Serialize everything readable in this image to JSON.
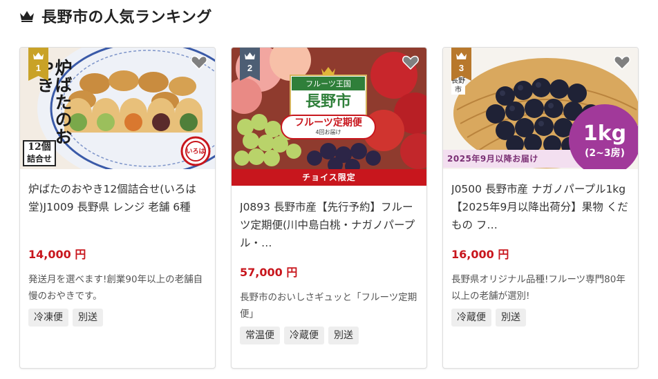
{
  "section": {
    "title": "長野市の人気ランキング",
    "icon": "crown-icon"
  },
  "colors": {
    "price": "#c8161d",
    "rank_1": "#c9a227",
    "rank_2": "#4d5e74",
    "rank_3": "#b8782c",
    "choice_bar": "#c8161d"
  },
  "items": [
    {
      "rank": "1",
      "title": "炉ばたのおやき12個詰合せ(いろは堂)J1009 長野県 レンジ 老舗 6種",
      "price": "14,000 円",
      "description": "発送月を選べます!創業90年以上の老舗自慢のおやきです。",
      "tags": [
        "冷凍便",
        "別送"
      ],
      "image_text": {
        "vertical_title": "炉ばたのおやき",
        "pack_line1": "12個",
        "pack_line2": "詰合せ",
        "logo_text": "いろは堂"
      }
    },
    {
      "rank": "2",
      "title": "J0893 長野市産【先行予約】フルーツ定期便(川中島白桃・ナガノパープル・…",
      "price": "57,000 円",
      "description": "長野市のおいしさギュッと「フルーツ定期便」",
      "tags": [
        "常温便",
        "冷蔵便",
        "別送"
      ],
      "banner": "チョイス限定",
      "image_text": {
        "kingdom": "フルーツ王国",
        "city": "長野市",
        "plan": "フルーツ定期便",
        "frequency": "4回お届け"
      }
    },
    {
      "rank": "3",
      "title": "J0500 長野市産 ナガノパープル1kg【2025年9月以降出荷分】果物 くだもの フ…",
      "price": "16,000 円",
      "description": "長野県オリジナル品種!フルーツ専門80年以上の老舗が選別!",
      "tags": [
        "冷蔵便",
        "別送"
      ],
      "image_text": {
        "origin_line1": "長野",
        "origin_line2": "市",
        "weight": "1kg",
        "count": "(2~3房)",
        "delivery": "2025年9月以降お届け"
      }
    }
  ]
}
